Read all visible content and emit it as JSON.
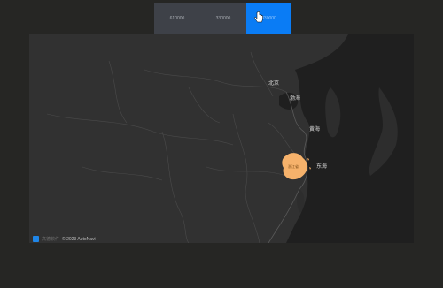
{
  "level_tabs": [
    {
      "label": "610000",
      "active": false
    },
    {
      "label": "330000",
      "active": false
    },
    {
      "label": "330000",
      "active": true
    }
  ],
  "map": {
    "labels": {
      "beijing": "北京",
      "bohai": "渤海",
      "huanghai": "黄海",
      "donghai": "东海",
      "zhejiang": "浙江省"
    },
    "highlight_color": "#f6b26b",
    "attribution": {
      "logo_text": "高德软件",
      "copyright": "© 2023 AutoNavi"
    }
  },
  "colors": {
    "accent": "#0a7cf5",
    "background": "#262624",
    "map_land": "#313131",
    "map_sea": "#1e1e1e"
  }
}
